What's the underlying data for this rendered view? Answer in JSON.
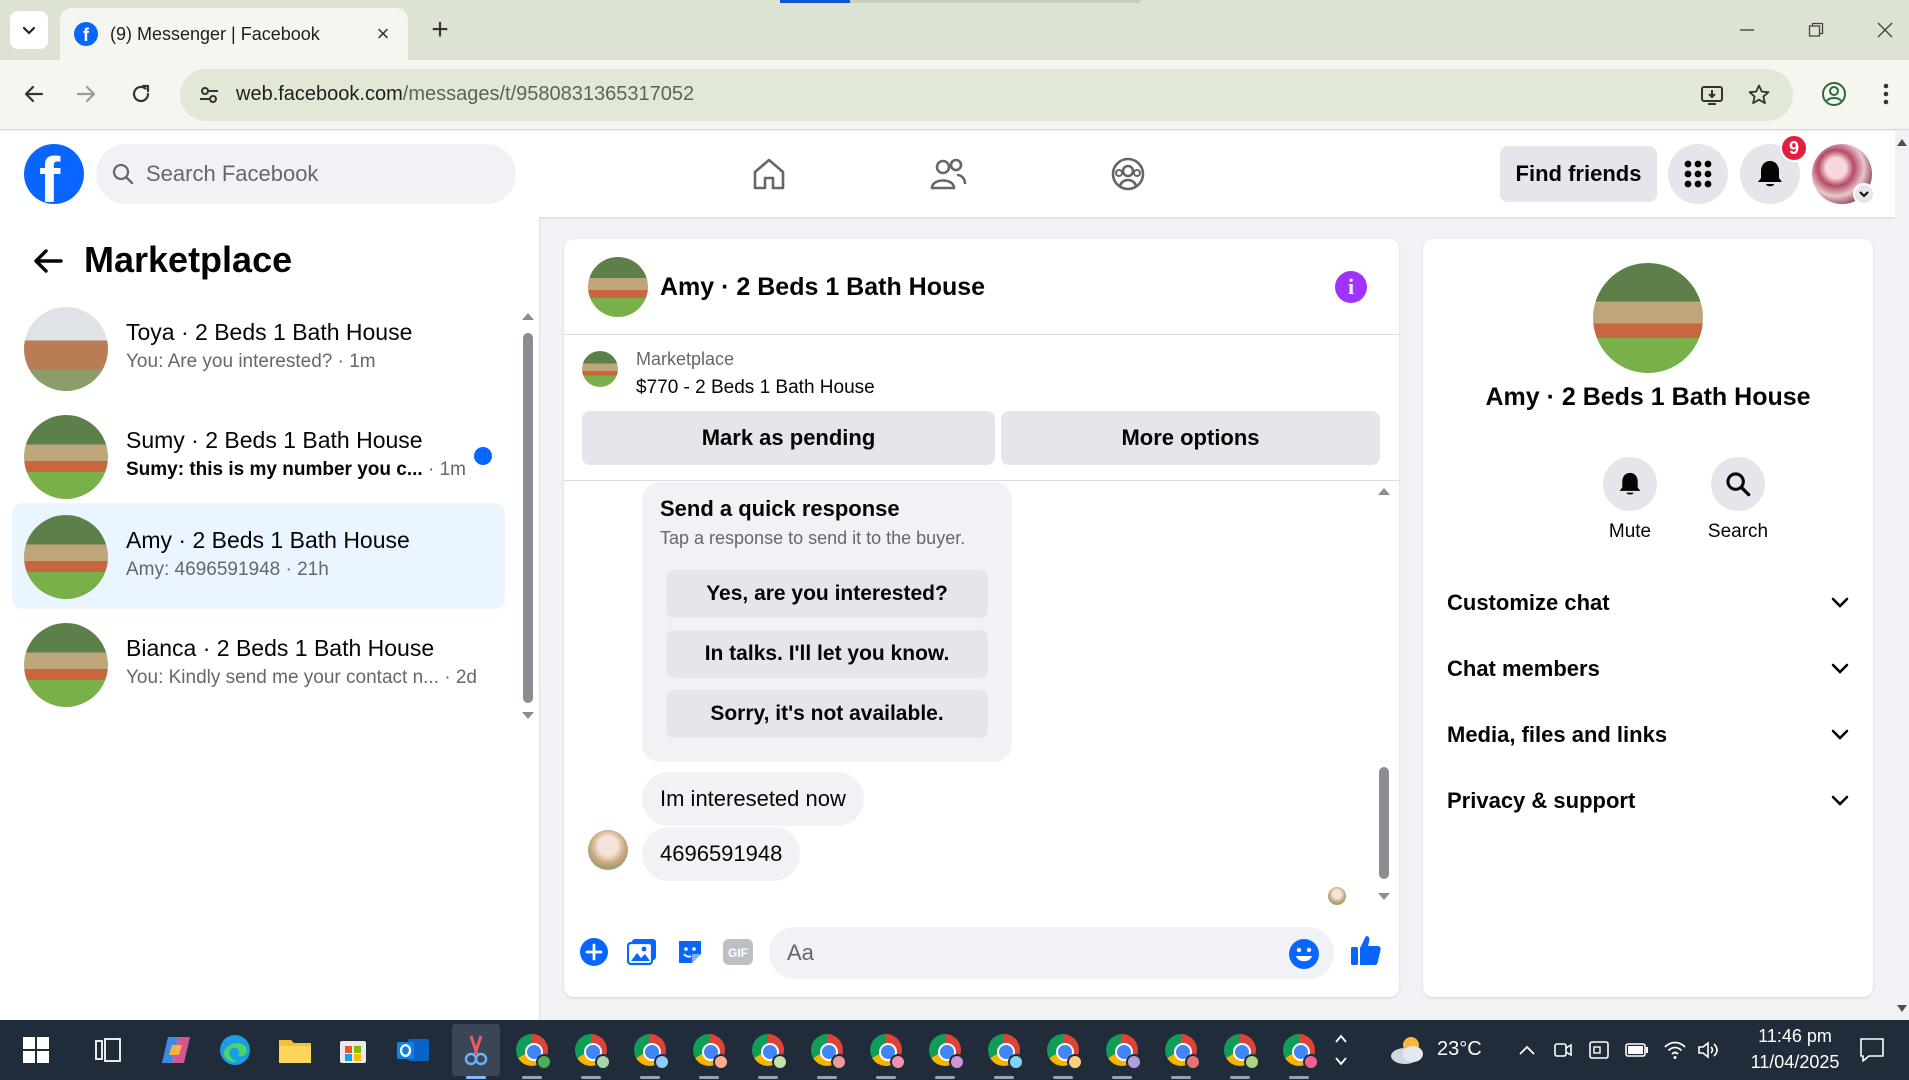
{
  "browser": {
    "tab_title": "(9) Messenger | Facebook",
    "url_host": "web.facebook.com",
    "url_path": "/messages/t/9580831365317052"
  },
  "fb_header": {
    "search_placeholder": "Search Facebook",
    "find_friends_label": "Find friends",
    "notification_count": "9",
    "brand_color": "#0866ff"
  },
  "left_panel": {
    "title": "Marketplace",
    "conversations": [
      {
        "name": "Toya · 2 Beds 1 Bath House",
        "snippet": "You: Are you interested?",
        "time": " · 1m",
        "unread": false,
        "active": false
      },
      {
        "name": "Sumy · 2 Beds 1 Bath House",
        "snippet": "Sumy: this is my number you c...",
        "time": " · 1m",
        "unread": true,
        "active": false
      },
      {
        "name": "Amy · 2 Beds 1 Bath House",
        "snippet": "Amy: 4696591948",
        "time": " · 21h",
        "unread": false,
        "active": true
      },
      {
        "name": "Bianca · 2 Beds 1 Bath House",
        "snippet": "You: Kindly send me your contact n...",
        "time": " · 2d",
        "unread": false,
        "active": false
      }
    ]
  },
  "chat": {
    "title": "Amy · 2 Beds 1 Bath House",
    "listing_source": "Marketplace",
    "listing_price_title": "$770 - 2 Beds 1 Bath House",
    "mark_pending_label": "Mark as pending",
    "more_options_label": "More options",
    "quick_response": {
      "title": "Send a quick response",
      "subtitle": "Tap a response to send it to the buyer.",
      "options": [
        "Yes, are you interested?",
        "In talks. I'll let you know.",
        "Sorry, it's not available."
      ]
    },
    "messages": [
      "Im intereseted now",
      "4696591948"
    ],
    "composer_placeholder": "Aa"
  },
  "right_panel": {
    "name": "Amy · 2 Beds 1 Bath House",
    "actions": [
      "Mute",
      "Search"
    ],
    "sections": [
      "Customize chat",
      "Chat members",
      "Media, files and links",
      "Privacy & support"
    ]
  },
  "taskbar": {
    "weather_temp": "23°C",
    "time": "11:46 pm",
    "date": "11/04/2025"
  }
}
